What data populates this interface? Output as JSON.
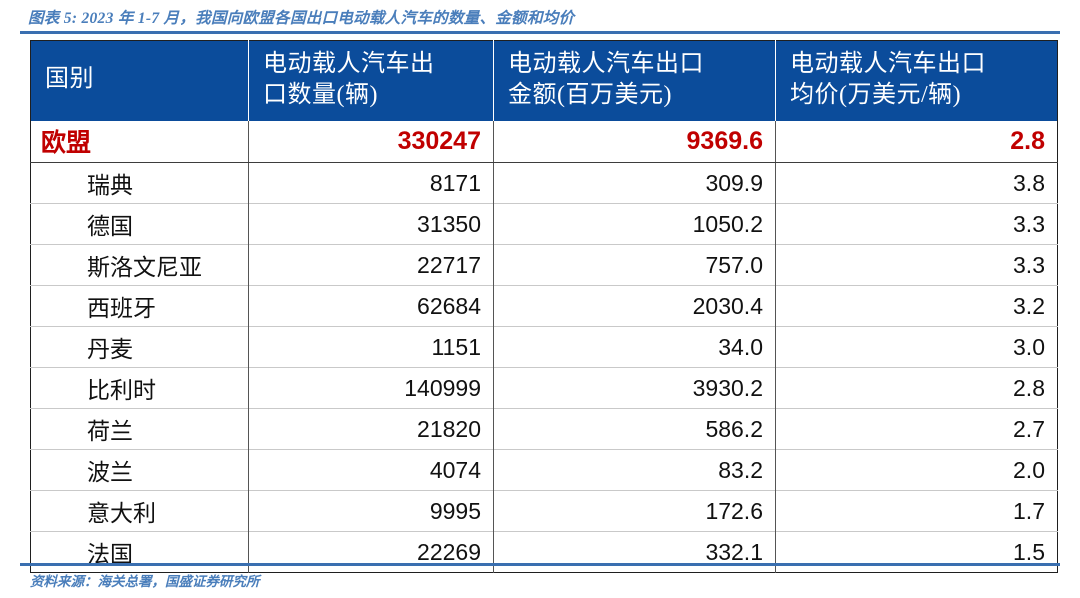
{
  "caption": "图表 5: 2023 年 1-7 月，我国向欧盟各国出口电动载人汽车的数量、金额和均价",
  "source_note": "资料来源：海关总署，国盛证券研究所",
  "colors": {
    "header_blue": "#0B4C9B",
    "rule_blue": "#3A6FB0",
    "caption_blue": "#4A7EBB",
    "highlight_red": "#C00000",
    "body_text": "#111111"
  },
  "table": {
    "headers": [
      "国别",
      "电动载人汽车出口数量(辆)",
      "电动载人汽车出口金额(百万美元)",
      "电动载人汽车出口均价(万美元/辆)"
    ],
    "header_lines": [
      [
        "国别"
      ],
      [
        "电动载人汽车出",
        "口数量(辆)"
      ],
      [
        "电动载人汽车出口",
        "金额(百万美元)"
      ],
      [
        "电动载人汽车出口",
        "均价(万美元/辆)"
      ]
    ],
    "rows": [
      {
        "country": "欧盟",
        "quantity": "330247",
        "amount": "9369.6",
        "avg_price": "2.8",
        "highlight": true
      },
      {
        "country": "瑞典",
        "quantity": "8171",
        "amount": "309.9",
        "avg_price": "3.8",
        "highlight": false
      },
      {
        "country": "德国",
        "quantity": "31350",
        "amount": "1050.2",
        "avg_price": "3.3",
        "highlight": false
      },
      {
        "country": "斯洛文尼亚",
        "quantity": "22717",
        "amount": "757.0",
        "avg_price": "3.3",
        "highlight": false
      },
      {
        "country": "西班牙",
        "quantity": "62684",
        "amount": "2030.4",
        "avg_price": "3.2",
        "highlight": false
      },
      {
        "country": "丹麦",
        "quantity": "1151",
        "amount": "34.0",
        "avg_price": "3.0",
        "highlight": false
      },
      {
        "country": "比利时",
        "quantity": "140999",
        "amount": "3930.2",
        "avg_price": "2.8",
        "highlight": false
      },
      {
        "country": "荷兰",
        "quantity": "21820",
        "amount": "586.2",
        "avg_price": "2.7",
        "highlight": false
      },
      {
        "country": "波兰",
        "quantity": "4074",
        "amount": "83.2",
        "avg_price": "2.0",
        "highlight": false
      },
      {
        "country": "意大利",
        "quantity": "9995",
        "amount": "172.6",
        "avg_price": "1.7",
        "highlight": false
      },
      {
        "country": "法国",
        "quantity": "22269",
        "amount": "332.1",
        "avg_price": "1.5",
        "highlight": false
      }
    ]
  },
  "chart_data": {
    "type": "table",
    "title": "图表 5: 2023 年 1-7 月，我国向欧盟各国出口电动载人汽车的数量、金额和均价",
    "columns": [
      "国别",
      "电动载人汽车出口数量(辆)",
      "电动载人汽车出口金额(百万美元)",
      "电动载人汽车出口均价(万美元/辆)"
    ],
    "categories": [
      "欧盟",
      "瑞典",
      "德国",
      "斯洛文尼亚",
      "西班牙",
      "丹麦",
      "比利时",
      "荷兰",
      "波兰",
      "意大利",
      "法国"
    ],
    "series": [
      {
        "name": "电动载人汽车出口数量(辆)",
        "values": [
          330247,
          8171,
          31350,
          22717,
          62684,
          1151,
          140999,
          21820,
          4074,
          9995,
          22269
        ]
      },
      {
        "name": "电动载人汽车出口金额(百万美元)",
        "values": [
          9369.6,
          309.9,
          1050.2,
          757.0,
          2030.4,
          34.0,
          3930.2,
          586.2,
          83.2,
          172.6,
          332.1
        ]
      },
      {
        "name": "电动载人汽车出口均价(万美元/辆)",
        "values": [
          2.8,
          3.8,
          3.3,
          3.3,
          3.2,
          3.0,
          2.8,
          2.7,
          2.0,
          1.7,
          1.5
        ]
      }
    ],
    "notes": "第一行“欧盟”为合计行，以红色加粗显示",
    "source": "资料来源：海关总署，国盛证券研究所"
  }
}
